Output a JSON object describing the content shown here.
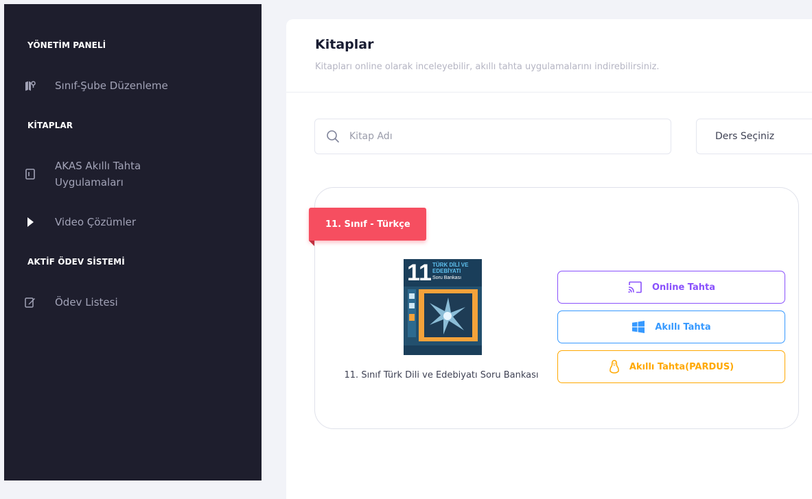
{
  "sidebar": {
    "section_admin": "YÖNETİM PANELİ",
    "item_sinif": "Sınıf-Şube Düzenleme",
    "section_books": "KİTAPLAR",
    "item_akas_line1": "AKAS Akıllı Tahta",
    "item_akas_line2": "Uygulamaları",
    "item_video": "Video Çözümler",
    "section_homework": "AKTİF ÖDEV SİSTEMİ",
    "item_odev": "Ödev Listesi"
  },
  "page": {
    "title": "Kitaplar",
    "subtitle": "Kitapları online olarak inceleyebilir, akıllı tahta uygulamalarını indirebilirsiniz."
  },
  "filters": {
    "search_placeholder": "Kitap Adı",
    "select_value": "Ders Seçiniz"
  },
  "book": {
    "ribbon": "11. Sınıf - Türkçe",
    "name": "11. Sınıf Türk Dili ve Edebiyatı Soru Bankası",
    "cover_number": "11",
    "cover_line1": "TÜRK DİLİ VE",
    "cover_line2": "EDEBİYATI",
    "cover_line3": "Soru Bankası",
    "buttons": {
      "online": "Online Tahta",
      "akilli": "Akıllı Tahta",
      "pardus": "Akıllı Tahta(PARDUS)"
    }
  },
  "colors": {
    "sidebar_bg": "#1e1e2d",
    "ribbon": "#f64e60",
    "online": "#8950fc",
    "akilli": "#3699ff",
    "pardus": "#ffa800"
  }
}
